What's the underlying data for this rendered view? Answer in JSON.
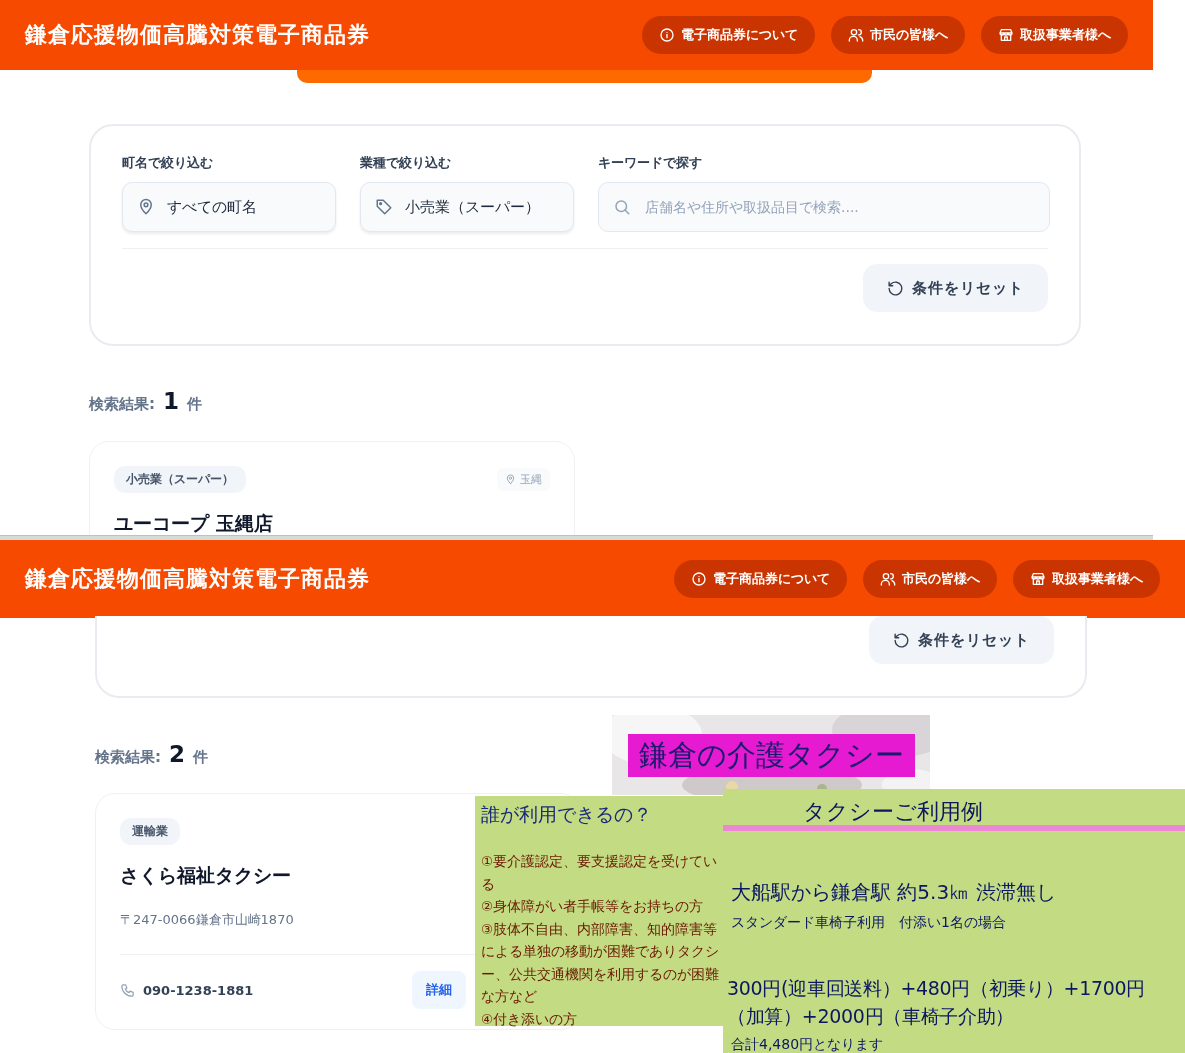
{
  "screens": [
    {
      "header": {
        "title": "鎌倉応援物価高騰対策電子商品券",
        "nav": [
          {
            "label": "電子商品券について"
          },
          {
            "label": "市民の皆様へ"
          },
          {
            "label": "取扱事業者様へ"
          }
        ]
      },
      "filters": {
        "groups": [
          {
            "label": "町名で絞り込む",
            "value": "すべての町名"
          },
          {
            "label": "業種で絞り込む",
            "value": "小売業（スーパー）"
          }
        ],
        "keyword": {
          "label": "キーワードで探す",
          "placeholder": "店舗名や住所や取扱品目で検索...."
        },
        "reset": "条件をリセット"
      },
      "results": {
        "label": "検索結果:",
        "count": "1",
        "unit": "件"
      },
      "stores": [
        {
          "category": "小売業（スーパー）",
          "area": "玉縄",
          "name": "ユーコープ 玉縄店"
        }
      ]
    },
    {
      "header": {
        "title": "鎌倉応援物価高騰対策電子商品券",
        "nav": [
          {
            "label": "電子商品券について"
          },
          {
            "label": "市民の皆様へ"
          },
          {
            "label": "取扱事業者様へ"
          }
        ]
      },
      "filters": {
        "reset": "条件をリセット"
      },
      "results": {
        "label": "検索結果:",
        "count": "2",
        "unit": "件"
      },
      "stores": [
        {
          "category": "運輸業",
          "name": "さくら福祉タクシー",
          "address": "〒247-0066鎌倉市山崎1870",
          "phone": "090-1238-1881",
          "details": "詳細"
        }
      ]
    }
  ],
  "overlays": {
    "banner": {
      "kind": "picture",
      "title": "鎌倉の介護タクシー"
    },
    "eligibility": {
      "heading": "誰が利用できるの？",
      "items": [
        "①要介護認定、要支援認定を受けている",
        "②身体障がい者手帳等をお持ちの方",
        "③肢体不自由、内部障害、知的障害等による単独の移動が困難でありタクシー、公共交通機関を利用するのが困難な方など",
        "④付き添いの方"
      ]
    },
    "fare": {
      "heading": "タクシーご利用例",
      "route": "大船駅から鎌倉駅 約5.3㎞ 渋滞無し",
      "condition": "スタンダード車椅子利用　付添い1名の場合",
      "breakdown": "300円(迎車回送料）+480円（初乗り）+1700円（加算）+2000円（車椅子介助）",
      "total": "合計4,480円となります"
    }
  }
}
